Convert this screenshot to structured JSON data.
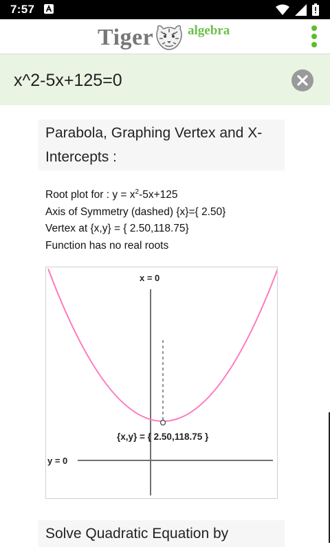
{
  "status": {
    "time": "7:57"
  },
  "header": {
    "logo_tiger": "Tiger",
    "logo_algebra": "algebra"
  },
  "input": {
    "value": "x^2-5x+125=0"
  },
  "section1": {
    "heading": "Parabola, Graphing Vertex and X-Intercepts :"
  },
  "info": {
    "root_plot_prefix": "Root plot for :  y = x",
    "root_plot_exp": "2",
    "root_plot_suffix": "-5x+125",
    "axis_line": "Axis of Symmetry (dashed)  {x}={ 2.50}",
    "vertex_line": "Vertex at  {x,y} = { 2.50,118.75}",
    "roots_line": "Function has no real roots"
  },
  "graph": {
    "x0_label": "x = 0",
    "y0_label": "y = 0",
    "vertex_label": "{x,y} = { 2.50,118.75 }",
    "curve_color": "#ff79bd"
  },
  "section2": {
    "heading": "Solve Quadratic Equation by"
  }
}
